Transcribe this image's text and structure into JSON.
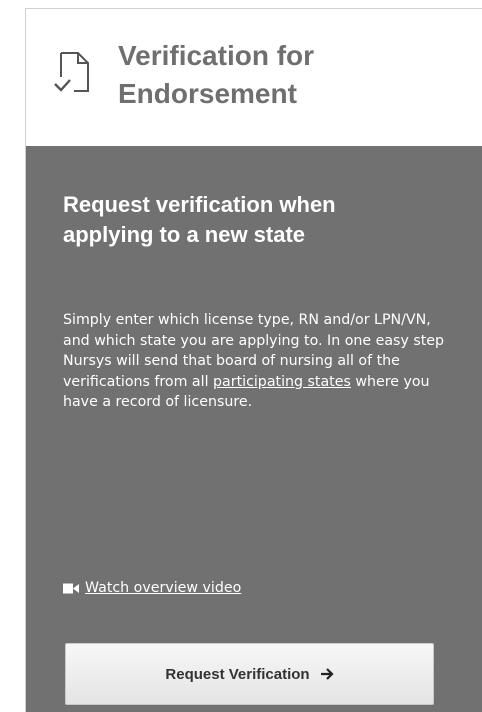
{
  "header": {
    "title": "Verification for\nEndorsement",
    "icon": "document-check-icon"
  },
  "body": {
    "title": "Request verification when\napplying to a new state",
    "description_before_link": "Simply enter which license type, RN and/or LPN/VN, and which state you are applying to. In one easy step Nursys will send that board of nursing all of the verifications from all ",
    "participating_link": "participating states",
    "description_after_link": " where you have a record of licensure.",
    "video_link": "Watch overview video",
    "video_icon": "video-camera-icon"
  },
  "button": {
    "label": "Request Verification",
    "icon": "arrow-right-icon"
  },
  "colors": {
    "panel_bg": "#717171",
    "header_text": "#6f6f6f",
    "button_bg": "#f0f0f0"
  }
}
